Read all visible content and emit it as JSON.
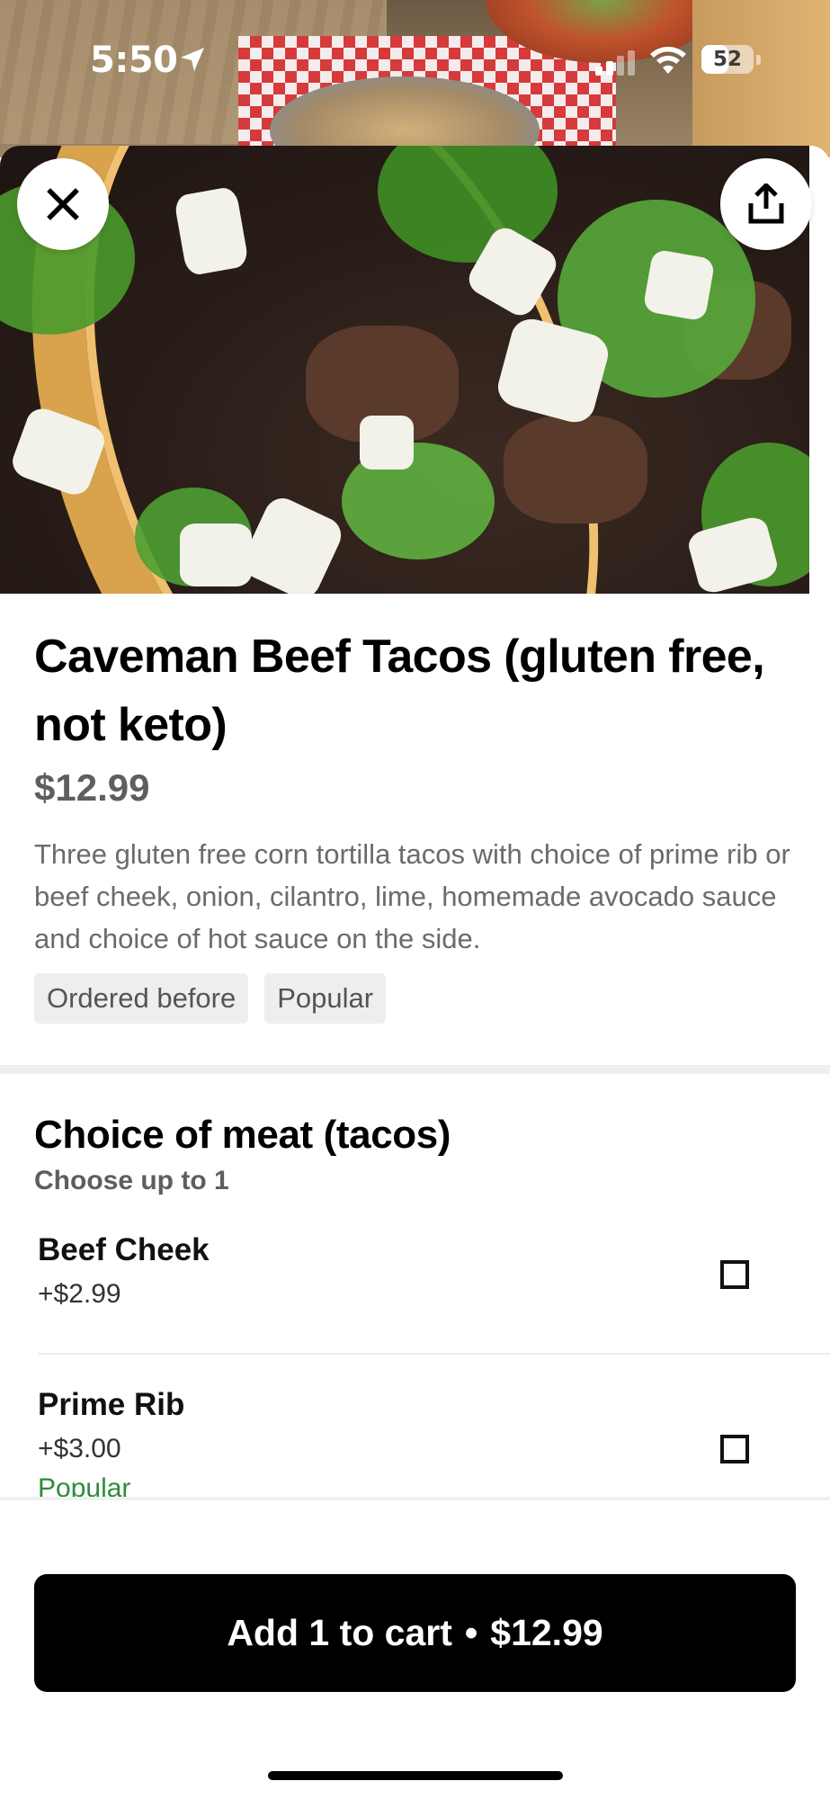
{
  "status_bar": {
    "time": "5:50",
    "battery_level": "52",
    "battery_fraction": 0.52,
    "icons": [
      "location-arrow-icon",
      "cellular-signal-icon",
      "wifi-icon",
      "battery-icon"
    ]
  },
  "header": {
    "close_icon": "close-icon",
    "share_icon": "share-icon"
  },
  "item": {
    "title": "Caveman Beef Tacos (gluten free, not keto)",
    "price": "$12.99",
    "description": "Three gluten free corn tortilla tacos with choice of prime rib or beef cheek, onion, cilantro, lime, homemade avocado sauce and choice of hot sauce on the side.",
    "tags": [
      "Ordered before",
      "Popular"
    ]
  },
  "options_group": {
    "title": "Choice of meat (tacos)",
    "subtitle": "Choose up to 1",
    "options": [
      {
        "name": "Beef Cheek",
        "price": "+$2.99",
        "badge": "",
        "checked": false
      },
      {
        "name": "Prime Rib",
        "price": "+$3.00",
        "badge": "Popular",
        "checked": false
      }
    ]
  },
  "cart": {
    "label": "Add 1 to cart",
    "separator": "•",
    "total": "$12.99"
  },
  "colors": {
    "popular_green": "#2e8b3c",
    "button_black": "#000000",
    "price_gray": "#5e5e5e"
  }
}
